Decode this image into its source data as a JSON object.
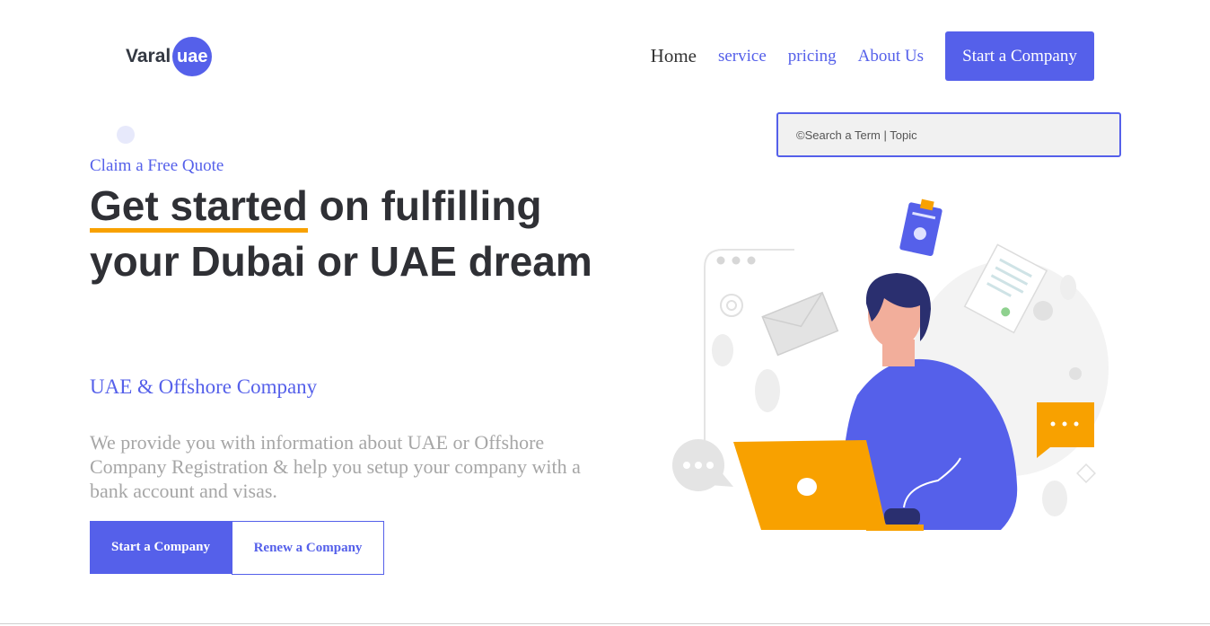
{
  "brand": {
    "name": "Varal",
    "badge": "uae"
  },
  "nav": {
    "items": [
      {
        "label": "Home"
      },
      {
        "label": "service"
      },
      {
        "label": "pricing"
      },
      {
        "label": "About Us"
      }
    ],
    "cta": "Start a Company"
  },
  "search": {
    "placeholder": "©Search a Term | Topic"
  },
  "hero": {
    "eyebrow": "Claim a Free Quote",
    "headline_highlight": "Get started",
    "headline_rest": " on fulfilling your Dubai or UAE dream",
    "subhead": "UAE & Offshore Company",
    "description": "We provide you with information about UAE or Offshore Company Registration & help you setup your company with a bank account and visas.",
    "primary_button": "Start a Company",
    "secondary_button": "Renew a Company"
  },
  "colors": {
    "accent": "#5560ea",
    "highlight": "#f8a100",
    "heading": "#2f3035",
    "muted": "#a6a6a6"
  }
}
